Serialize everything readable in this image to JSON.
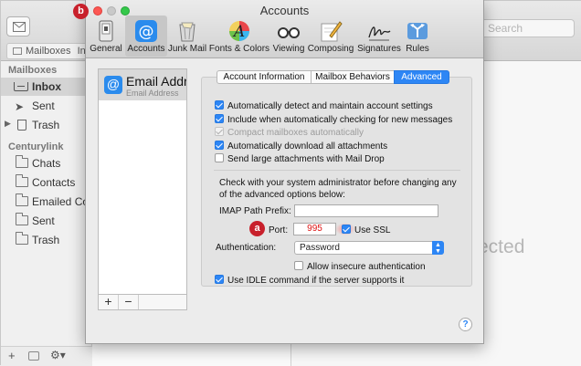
{
  "mail": {
    "search_placeholder": "Search",
    "favbar_label": "Mailboxes",
    "favbar_extra": "In",
    "sidebar": {
      "section1": "Mailboxes",
      "section2": "Centurylink",
      "items": [
        {
          "label": "Inbox"
        },
        {
          "label": "Sent"
        },
        {
          "label": "Trash"
        }
      ],
      "folders": [
        {
          "label": "Chats"
        },
        {
          "label": "Contacts"
        },
        {
          "label": "Emailed Con"
        },
        {
          "label": "Sent"
        },
        {
          "label": "Trash"
        }
      ],
      "bottom": {
        "add": "+",
        "gear": "⚙▾"
      }
    },
    "preview_text": "ected"
  },
  "prefs": {
    "title": "Accounts",
    "toolbar": [
      {
        "label": "General",
        "icon": "general-icon"
      },
      {
        "label": "Accounts",
        "icon": "at-sign-icon"
      },
      {
        "label": "Junk Mail",
        "icon": "junk-mail-icon"
      },
      {
        "label": "Fonts & Colors",
        "icon": "font-palette-icon"
      },
      {
        "label": "Viewing",
        "icon": "glasses-icon"
      },
      {
        "label": "Composing",
        "icon": "pencil-note-icon"
      },
      {
        "label": "Signatures",
        "icon": "signature-icon"
      },
      {
        "label": "Rules",
        "icon": "rules-icon"
      }
    ],
    "account": {
      "name": "Email Addre",
      "address": "Email Address"
    },
    "list_buttons": {
      "add": "+",
      "remove": "−"
    },
    "tabs": [
      "Account Information",
      "Mailbox Behaviors",
      "Advanced"
    ],
    "checkboxes": [
      {
        "label": "Automatically detect and maintain account settings",
        "checked": true
      },
      {
        "label": "Include when automatically checking for new messages",
        "checked": true
      },
      {
        "label": "Compact mailboxes automatically",
        "checked": true,
        "disabled": true
      },
      {
        "label": "Automatically download all attachments",
        "checked": true
      },
      {
        "label": "Send large attachments with Mail Drop",
        "checked": false
      }
    ],
    "note": "Check with your system administrator before changing any of the advanced options below:",
    "imap_label": "IMAP Path Prefix:",
    "imap_value": "",
    "port_label": "Port:",
    "port_value": "995",
    "ssl_label": "Use SSL",
    "auth_label": "Authentication:",
    "auth_value": "Password",
    "insecure_label": "Allow insecure authentication",
    "idle_label": "Use IDLE command if the server supports it",
    "help": "?"
  },
  "annotations": {
    "a": "a",
    "b": "b"
  },
  "colors": {
    "accent": "#2d86f5",
    "badge": "#c8202b",
    "close": "#fc5753",
    "zoom": "#34c84a"
  }
}
